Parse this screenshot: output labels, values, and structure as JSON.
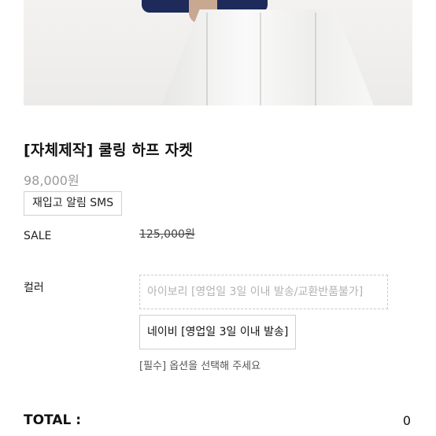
{
  "product": {
    "title": "[자체제작] 쿨링 하프 자켓",
    "price": "98,000원",
    "restock_button": "재입고 알림 SMS",
    "sale_label": "SALE",
    "sale_original_price": "125,000원"
  },
  "options": {
    "label": "컬러",
    "items": [
      {
        "label": "아이보리 [영업일 3일 이내 발송/교환반품불가]",
        "state": "disabled"
      },
      {
        "label": "네이비 [영업일 3일 이내 발송]",
        "state": "available"
      }
    ],
    "hint": "[필수] 옵션을 선택해 주세요"
  },
  "total": {
    "label": "TOTAL :",
    "value": "0"
  },
  "colors": {
    "jacket_navy": "#1d2a5a",
    "muted_text": "#9a9a9a",
    "border": "#cfcfcf"
  }
}
